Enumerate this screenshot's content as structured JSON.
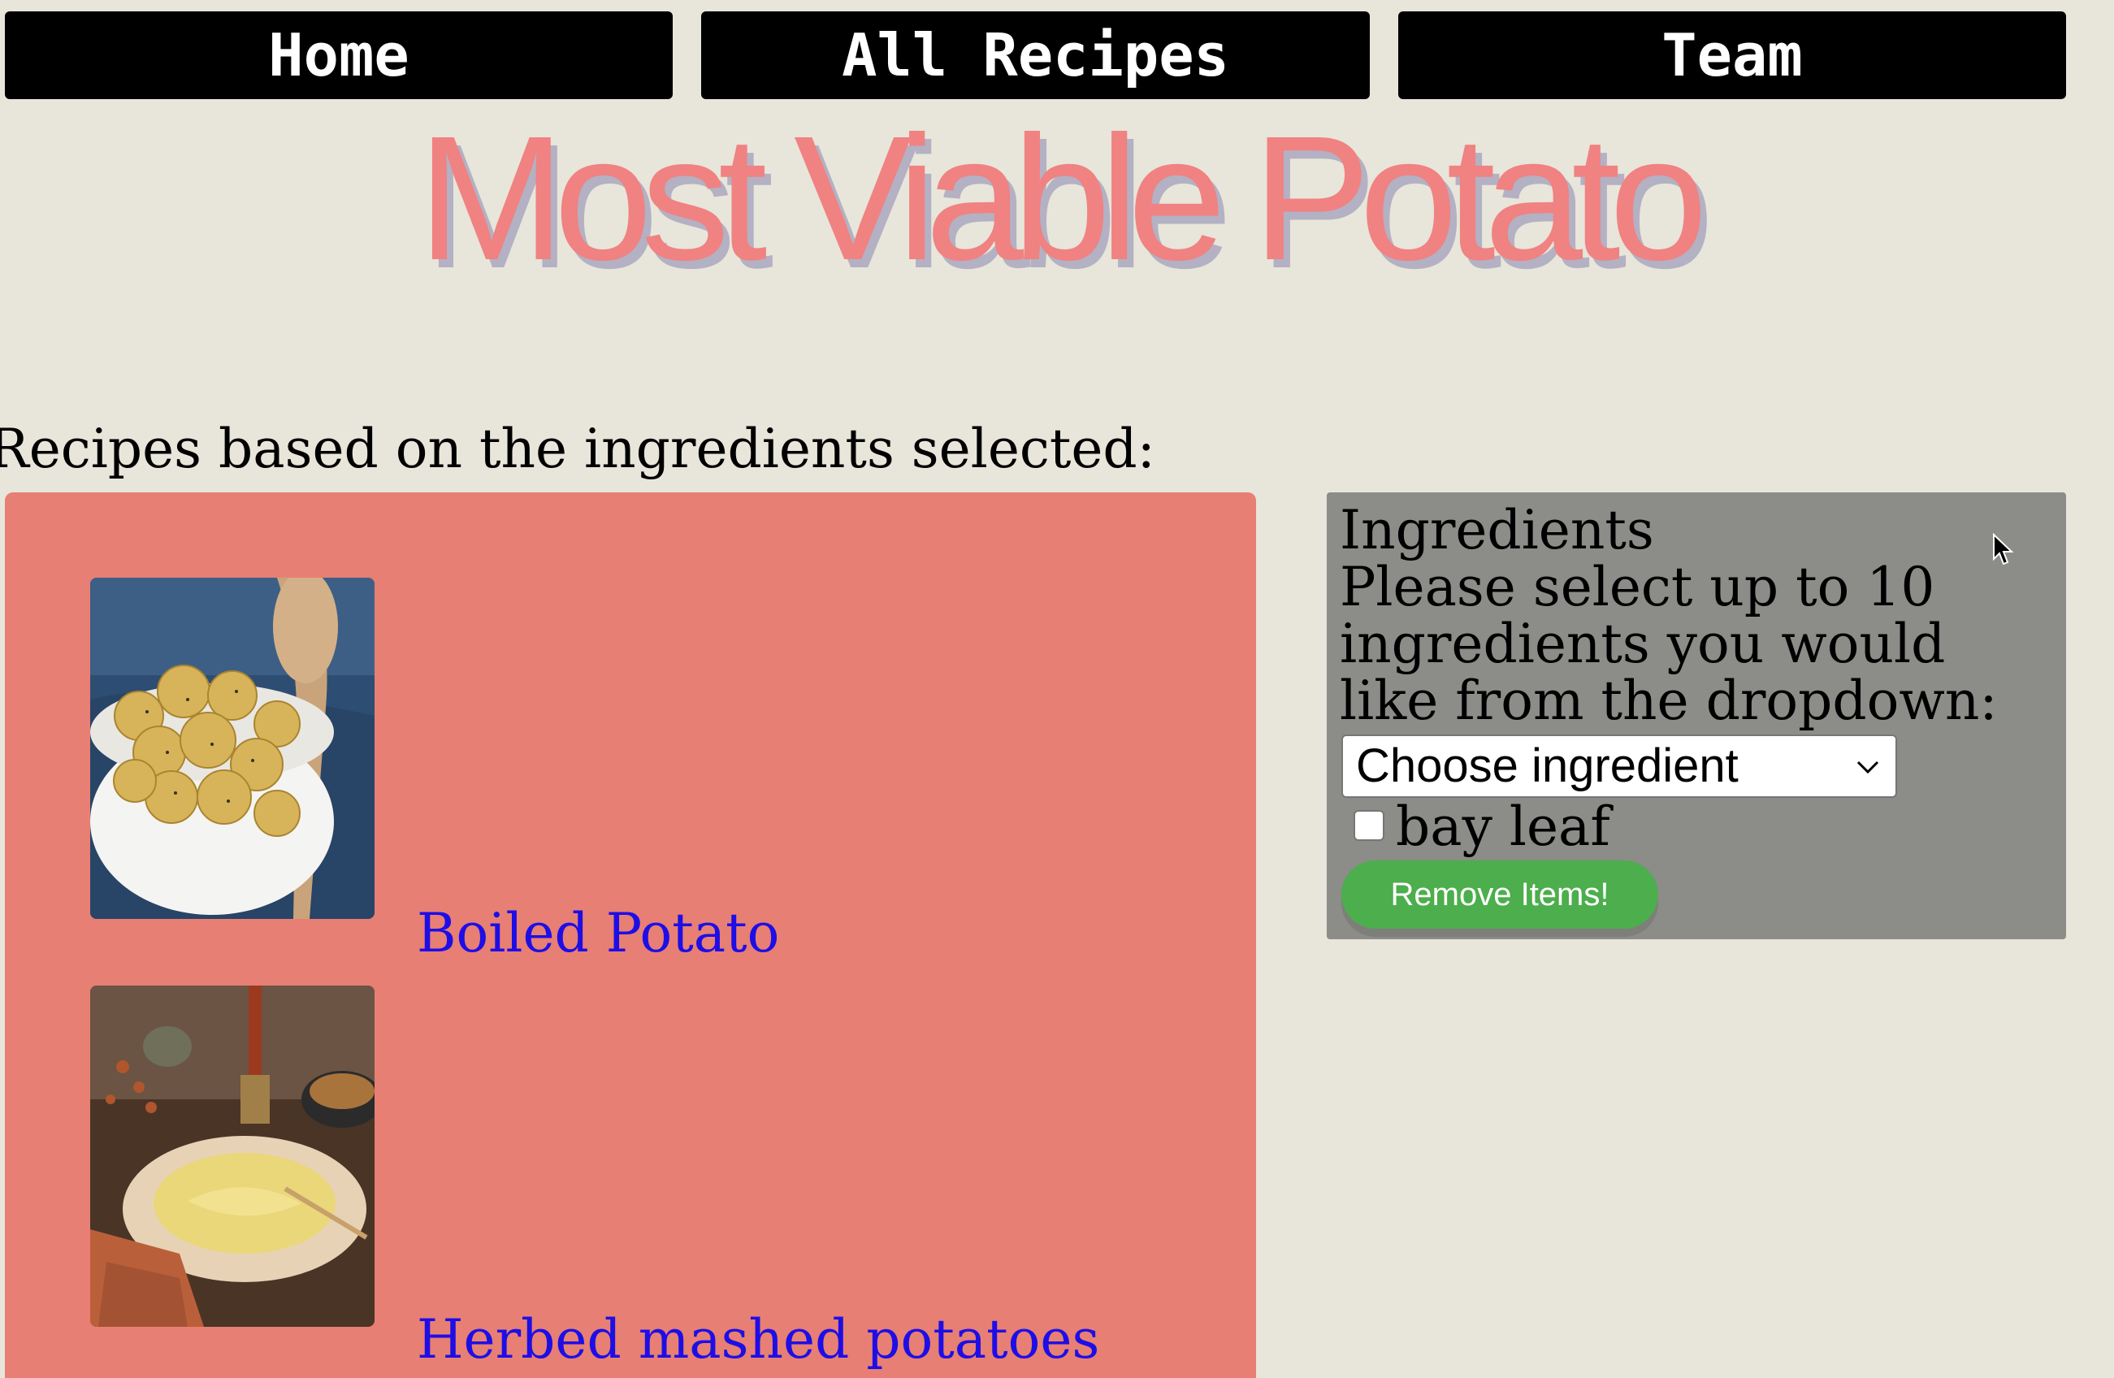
{
  "nav": {
    "home": "Home",
    "all_recipes": "All Recipes",
    "team": "Team"
  },
  "site_title": "Most Viable Potato",
  "recipes_heading": "Recipes based on the ingredients selected:",
  "recipes": [
    {
      "name": "Boiled Potato",
      "image": "bowl-of-boiled-potatoes-photo"
    },
    {
      "name": "Herbed mashed potatoes",
      "image": "mashed-potatoes-table-photo"
    }
  ],
  "ingredients": {
    "title": "Ingredients",
    "instructions": "Please select up to 10 ingredients you would like from the dropdown:",
    "select_value": "Choose ingredient",
    "selected_items": [
      {
        "label": "bay leaf",
        "checked": false
      }
    ],
    "remove_button": "Remove Items!"
  },
  "colors": {
    "background": "#e8e5da",
    "nav_button": "#000000",
    "title": "#f08282",
    "title_shadow": "#b3b1c3",
    "recipes_panel": "#e77f74",
    "link": "#1e0ee6",
    "ingredients_panel": "#8c8c89",
    "remove_button": "#4cae4c"
  }
}
